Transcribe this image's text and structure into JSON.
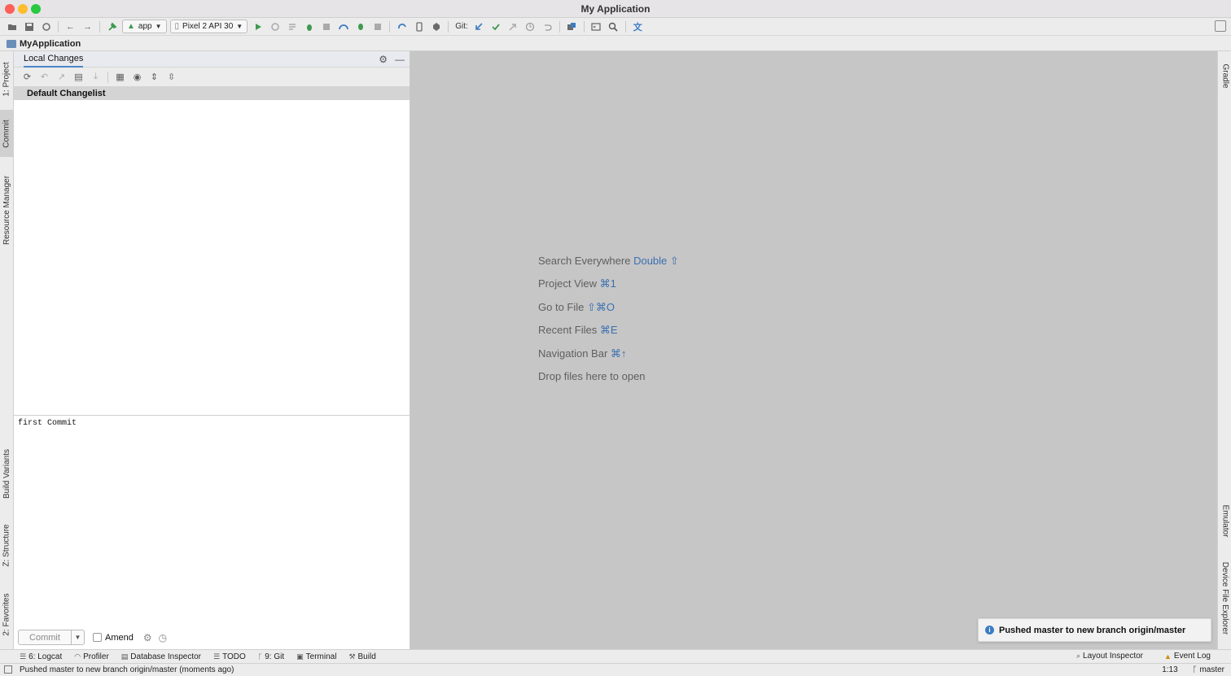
{
  "window": {
    "title": "My Application"
  },
  "toolbar": {
    "module_combo": "app",
    "device_combo": "Pixel 2 API 30",
    "git_label": "Git:",
    "colors": {
      "run": "#3f9a4f",
      "git_update": "#3c7cc2",
      "git_commit": "#3f9a4f"
    }
  },
  "breadcrumb": {
    "project": "MyApplication"
  },
  "left_stripe": {
    "tabs": [
      "1: Project",
      "Commit",
      "Resource Manager",
      "Build Variants",
      "Z: Structure",
      "2: Favorites"
    ]
  },
  "right_stripe": {
    "tabs": [
      "Gradle",
      "Emulator",
      "Device File Explorer"
    ]
  },
  "commit_panel": {
    "tab_label": "Local Changes",
    "changelist": "Default Changelist",
    "commit_message": "first Commit",
    "commit_button": "Commit",
    "amend_label": "Amend"
  },
  "editor": {
    "hints": [
      {
        "text": "Search Everywhere",
        "shortcut": "Double ⇧"
      },
      {
        "text": "Project View",
        "shortcut": "⌘1"
      },
      {
        "text": "Go to File",
        "shortcut": "⇧⌘O"
      },
      {
        "text": "Recent Files",
        "shortcut": "⌘E"
      },
      {
        "text": "Navigation Bar",
        "shortcut": "⌘↑"
      },
      {
        "text": "Drop files here to open",
        "shortcut": ""
      }
    ]
  },
  "notification": {
    "text": "Pushed master to new branch origin/master"
  },
  "bottom_tabs": {
    "logcat": "6: Logcat",
    "profiler": "Profiler",
    "database": "Database Inspector",
    "todo": "TODO",
    "git": "9: Git",
    "terminal": "Terminal",
    "build": "Build",
    "layout_inspector": "Layout Inspector",
    "event_log": "Event Log"
  },
  "status_bar": {
    "message": "Pushed master to new branch origin/master (moments ago)",
    "position": "1:13",
    "branch": "master"
  }
}
